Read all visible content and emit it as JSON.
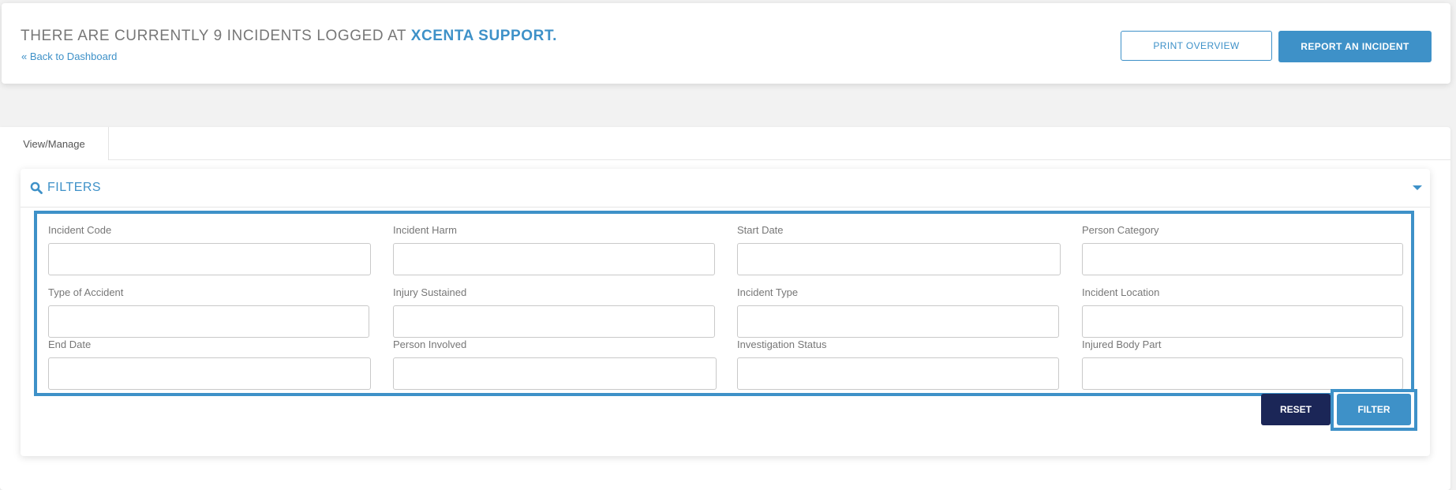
{
  "header": {
    "title_prefix": "THERE ARE CURRENTLY 9 INCIDENTS LOGGED AT",
    "org_name": "XCENTA SUPPORT.",
    "back_link": "« Back to Dashboard",
    "print_button": "PRINT OVERVIEW",
    "report_button": "REPORT AN INCIDENT"
  },
  "tabs": [
    {
      "label": "View/Manage",
      "active": true
    }
  ],
  "filters": {
    "title": "FILTERS",
    "icons": {
      "search": "search-icon",
      "toggle": "chevron-down-icon"
    },
    "fields": [
      {
        "label": "Incident Code",
        "value": ""
      },
      {
        "label": "Incident Harm",
        "value": ""
      },
      {
        "label": "Start Date",
        "value": ""
      },
      {
        "label": "Person Category",
        "value": ""
      },
      {
        "label": "Type of Accident",
        "value": ""
      },
      {
        "label": "Injury Sustained",
        "value": ""
      },
      {
        "label": "Incident Type",
        "value": ""
      },
      {
        "label": "Incident Location",
        "value": ""
      },
      {
        "label": "End Date",
        "value": ""
      },
      {
        "label": "Person Involved",
        "value": ""
      },
      {
        "label": "Investigation Status",
        "value": ""
      },
      {
        "label": "Injured Body Part",
        "value": ""
      }
    ],
    "reset_button": "RESET",
    "filter_button": "FILTER"
  },
  "colors": {
    "accent": "#3e91c8",
    "dark_button": "#1b2657",
    "background": "#f2f2f2"
  }
}
